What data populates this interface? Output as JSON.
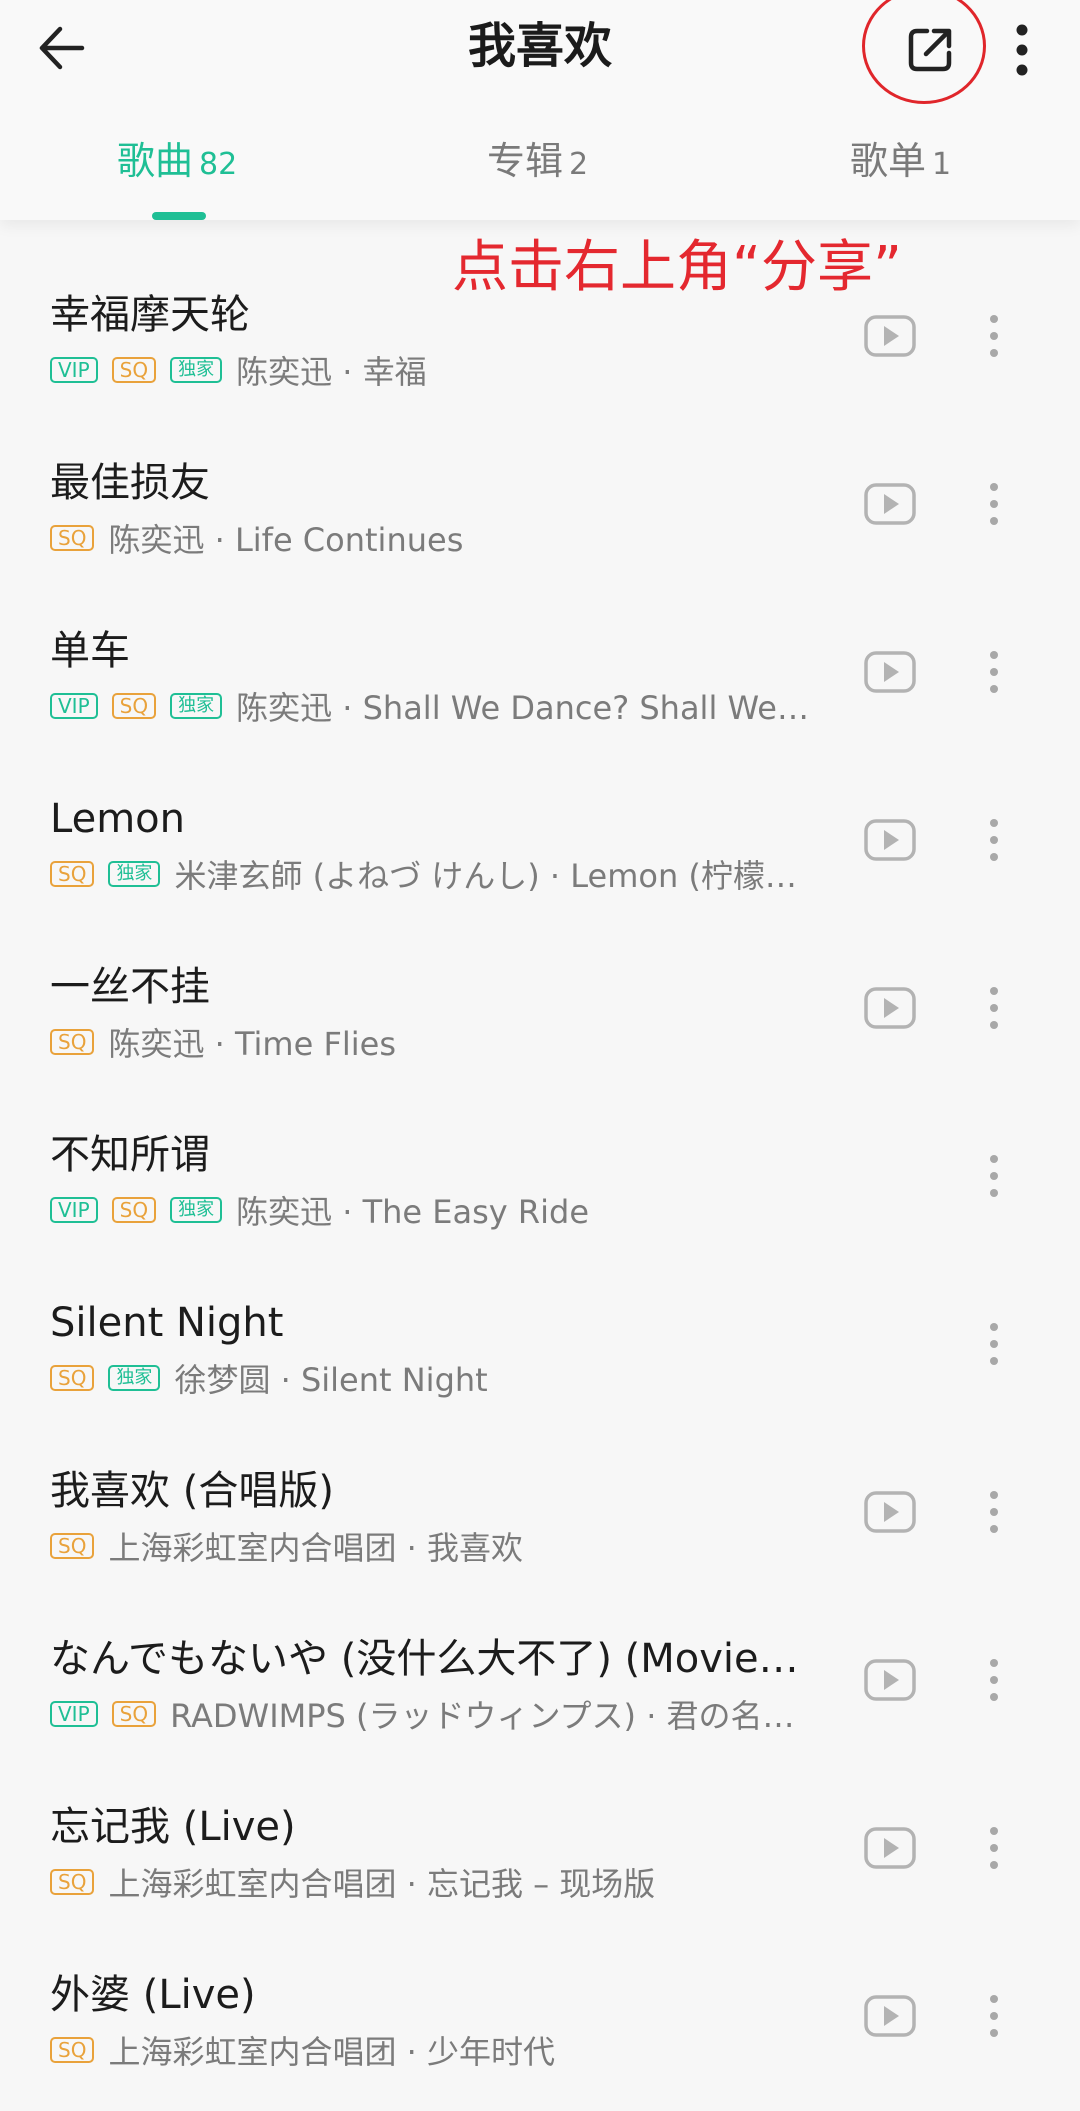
{
  "header": {
    "title": "我喜欢",
    "back_icon": "arrow-left-icon",
    "share_icon": "share-external-icon",
    "more_icon": "more-vertical-icon"
  },
  "tabs": [
    {
      "label": "歌曲",
      "count": "82",
      "active": true
    },
    {
      "label": "专辑",
      "count": "2",
      "active": false
    },
    {
      "label": "歌单",
      "count": "1",
      "active": false
    }
  ],
  "annotation": "点击右上角“分享”",
  "colors": {
    "accent": "#1fbf95",
    "sq": "#e9a23b",
    "annotation": "#e4282f"
  },
  "badge_labels": {
    "vip": "VIP",
    "sq": "SQ",
    "excl": "独家"
  },
  "songs": [
    {
      "title": "幸福摩天轮",
      "subtitle": "陈奕迅 · 幸福",
      "vip": true,
      "sq": true,
      "excl": true,
      "play": true
    },
    {
      "title": "最佳损友",
      "subtitle": "陈奕迅 · Life Continues",
      "vip": false,
      "sq": true,
      "excl": false,
      "play": true
    },
    {
      "title": "单车",
      "subtitle": "陈奕迅 · Shall We Dance? Shall We…",
      "vip": true,
      "sq": true,
      "excl": true,
      "play": true
    },
    {
      "title": "Lemon",
      "subtitle": "米津玄師 (よねづ けんし) · Lemon (柠檬…",
      "vip": false,
      "sq": true,
      "excl": true,
      "play": true
    },
    {
      "title": "一丝不挂",
      "subtitle": "陈奕迅 · Time Flies",
      "vip": false,
      "sq": true,
      "excl": false,
      "play": true
    },
    {
      "title": "不知所谓",
      "subtitle": "陈奕迅 · The Easy Ride",
      "vip": true,
      "sq": true,
      "excl": true,
      "play": false
    },
    {
      "title": "Silent Night",
      "subtitle": "徐梦圆 · Silent Night",
      "vip": false,
      "sq": true,
      "excl": true,
      "play": false
    },
    {
      "title": "我喜欢 (合唱版)",
      "subtitle": "上海彩虹室内合唱团 · 我喜欢",
      "vip": false,
      "sq": true,
      "excl": false,
      "play": true
    },
    {
      "title": "なんでもないや (没什么大不了) (Movie…",
      "subtitle": "RADWIMPS (ラッドウィンプス) · 君の名…",
      "vip": true,
      "sq": true,
      "excl": false,
      "play": true
    },
    {
      "title": "忘记我 (Live)",
      "subtitle": "上海彩虹室内合唱团 · 忘记我 – 现场版",
      "vip": false,
      "sq": true,
      "excl": false,
      "play": true
    },
    {
      "title": "外婆 (Live)",
      "subtitle": "上海彩虹室内合唱团 · 少年时代",
      "vip": false,
      "sq": true,
      "excl": false,
      "play": true
    }
  ]
}
